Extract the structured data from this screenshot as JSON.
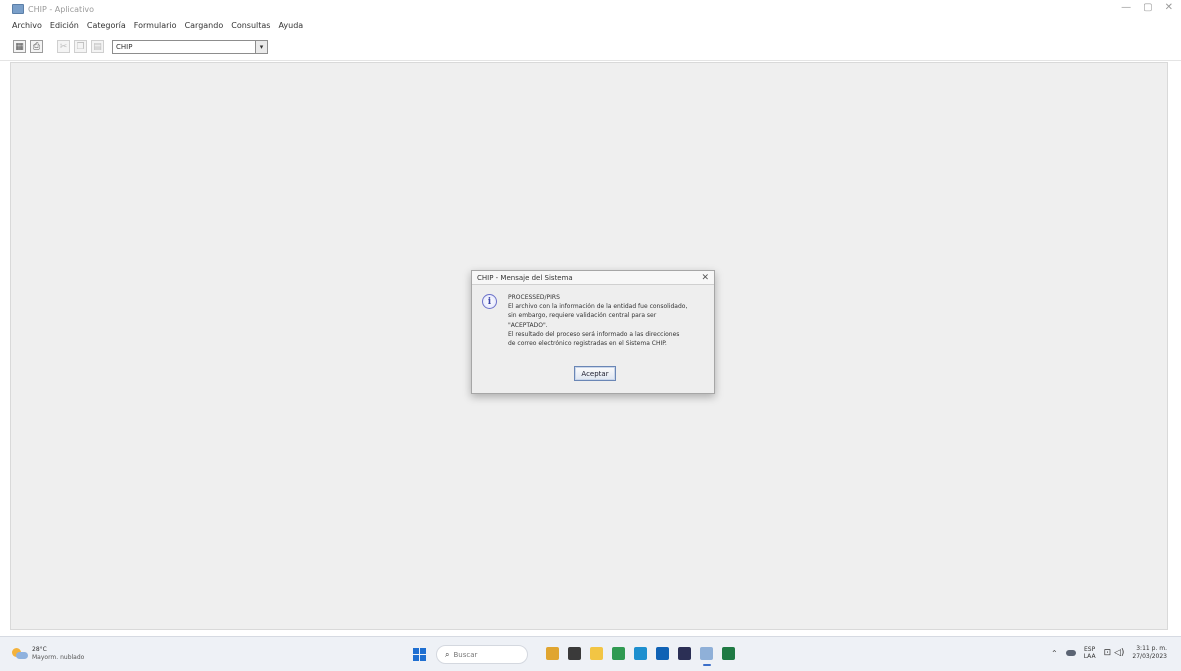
{
  "window": {
    "title": "CHIP - Aplicativo",
    "minimize_glyph": "—",
    "maximize_glyph": "▢",
    "close_glyph": "✕"
  },
  "menu": {
    "items": [
      "Archivo",
      "Edición",
      "Categoría",
      "Formulario",
      "Cargando",
      "Consultas",
      "Ayuda"
    ]
  },
  "toolbar": {
    "combo_value": "CHIP",
    "combo_arrow": "▾",
    "icons": [
      "grid-icon",
      "print-icon",
      "cut-icon",
      "copy-icon",
      "paste-icon"
    ]
  },
  "dialog": {
    "title": "CHIP - Mensaje del Sistema",
    "close_glyph": "✕",
    "info_glyph": "i",
    "lines": [
      "PROCESSED/PIRS",
      "El archivo con la información de la entidad fue consolidado,",
      "sin embargo, requiere validación central para ser",
      "\"ACEPTADO\".",
      "El resultado del proceso será informado a las direcciones",
      "de correo electrónico registradas en el Sistema CHIP."
    ],
    "ok_label": "Aceptar"
  },
  "taskbar": {
    "weather_temp": "28°C",
    "weather_desc": "Mayorm. nublado",
    "search_glyph": "⌕",
    "search_label": "Buscar",
    "apps": [
      {
        "name": "taskbar-app-files-icon",
        "color": "#e0a530"
      },
      {
        "name": "taskbar-app-dark-icon",
        "color": "#3a3a3a"
      },
      {
        "name": "taskbar-app-explorer-icon",
        "color": "#f2c544"
      },
      {
        "name": "taskbar-app-chrome-icon",
        "color": "#2f9a52"
      },
      {
        "name": "taskbar-app-edge-icon",
        "color": "#1d8fcf"
      },
      {
        "name": "taskbar-app-outlook-icon",
        "color": "#0f62b5"
      },
      {
        "name": "taskbar-app-teams-icon",
        "color": "#2b2f55"
      },
      {
        "name": "taskbar-app-java-icon",
        "color": "#8fb0d8",
        "active": true
      },
      {
        "name": "taskbar-app-excel-icon",
        "color": "#1f7a44"
      }
    ],
    "tray_chevron": "⌃",
    "lang_top": "ESP",
    "lang_bottom": "LAA",
    "net_glyph": "⊡ ◁)",
    "time": "3:11 p. m.",
    "date": "27/03/2023"
  },
  "colors": {
    "workspace_bg": "#efefef",
    "dialog_bg": "#eeeeee",
    "accent_blue": "#1f6fd1",
    "taskbar_bg": "#eef1f6"
  }
}
